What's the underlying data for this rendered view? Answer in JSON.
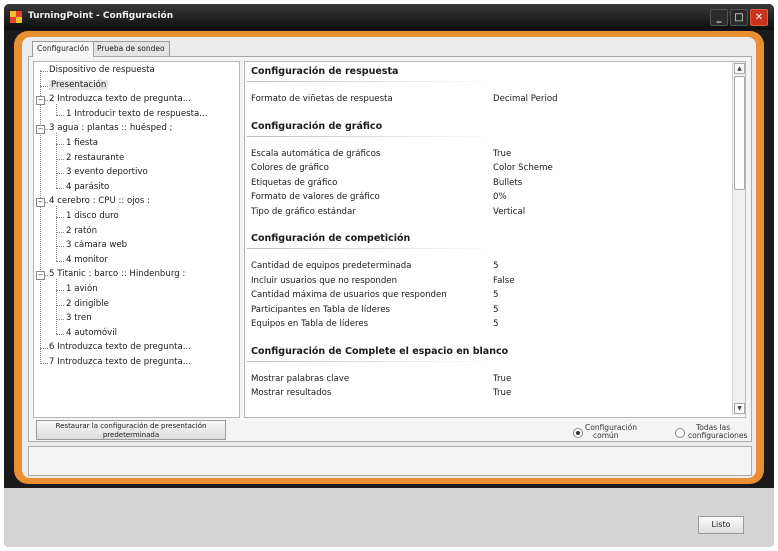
{
  "window": {
    "title": "TurningPoint - Configuración",
    "minimize_glyph": "_",
    "maximize_glyph": "□",
    "close_glyph": "✕"
  },
  "tabs": [
    {
      "label": "Configuración",
      "selected": true
    },
    {
      "label": "Prueba de sondeo",
      "selected": false
    }
  ],
  "tree": {
    "items": [
      {
        "label": "Dispositivo de respuesta",
        "level": 0
      },
      {
        "label": "Presentación",
        "level": 0,
        "selected": true
      },
      {
        "label": "2  Introduzca texto de pregunta...",
        "level": 0,
        "expander": "−"
      },
      {
        "label": "1  Introducir texto de respuesta...",
        "level": 1
      },
      {
        "label": "3  agua : plantas :: huésped ;",
        "level": 0,
        "expander": "−"
      },
      {
        "label": "1  fiesta",
        "level": 1
      },
      {
        "label": "2  restaurante",
        "level": 1
      },
      {
        "label": "3  evento deportivo",
        "level": 1
      },
      {
        "label": "4  parásito",
        "level": 1
      },
      {
        "label": "4  cerebro : CPU :: ojos :",
        "level": 0,
        "expander": "−"
      },
      {
        "label": "1  disco duro",
        "level": 1
      },
      {
        "label": "2  ratón",
        "level": 1
      },
      {
        "label": "3  cámara web",
        "level": 1
      },
      {
        "label": "4  monitor",
        "level": 1
      },
      {
        "label": "5  Titanic : barco :: Hindenburg :",
        "level": 0,
        "expander": "−"
      },
      {
        "label": "1  avión",
        "level": 1
      },
      {
        "label": "2  dirigible",
        "level": 1
      },
      {
        "label": "3  tren",
        "level": 1
      },
      {
        "label": "4  automóvil",
        "level": 1
      },
      {
        "label": "6  Introduzca texto de pregunta...",
        "level": 0
      },
      {
        "label": "7  Introduzca texto de pregunta...",
        "level": 0
      }
    ]
  },
  "restore_button": {
    "line1": "Restaurar la configuración de presentación",
    "line2": "predeterminada"
  },
  "settings": {
    "sections": [
      {
        "header": "Configuración de respuesta",
        "rows": [
          {
            "label": "Formato de viñetas de respuesta",
            "value": "Decimal Period"
          }
        ]
      },
      {
        "header": "Configuración de gráfico",
        "rows": [
          {
            "label": "Escala automática de gráficos",
            "value": "True"
          },
          {
            "label": "Colores de gráfico",
            "value": "Color Scheme"
          },
          {
            "label": "Etiquetas de gráfico",
            "value": "Bullets"
          },
          {
            "label": "Formato de valores de gráfico",
            "value": "0%"
          },
          {
            "label": "Tipo de gráfico estándar",
            "value": "Vertical"
          }
        ]
      },
      {
        "header": "Configuración de competición",
        "rows": [
          {
            "label": "Cantidad de equipos predeterminada",
            "value": "5"
          },
          {
            "label": "Incluir usuarios que no responden",
            "value": "False"
          },
          {
            "label": "Cantidad máxima de usuarios que responden",
            "value": "5"
          },
          {
            "label": "Participantes en Tabla de líderes",
            "value": "5"
          },
          {
            "label": "Equipos en Tabla de líderes",
            "value": "5"
          }
        ]
      },
      {
        "header": "Configuración de Complete el espacio en blanco",
        "rows": [
          {
            "label": "Mostrar palabras clave",
            "value": "True"
          },
          {
            "label": "Mostrar resultados",
            "value": "True"
          }
        ]
      }
    ]
  },
  "view_options": [
    {
      "line1": "Configuración",
      "line2": "común",
      "selected": true
    },
    {
      "line1": "Todas las",
      "line2": "configuraciones",
      "selected": false
    }
  ],
  "done_button": "Listo",
  "colors": {
    "frame_accent": "#e98f33",
    "title_bar": "#1a1a1a",
    "close_button": "#c8321c"
  }
}
